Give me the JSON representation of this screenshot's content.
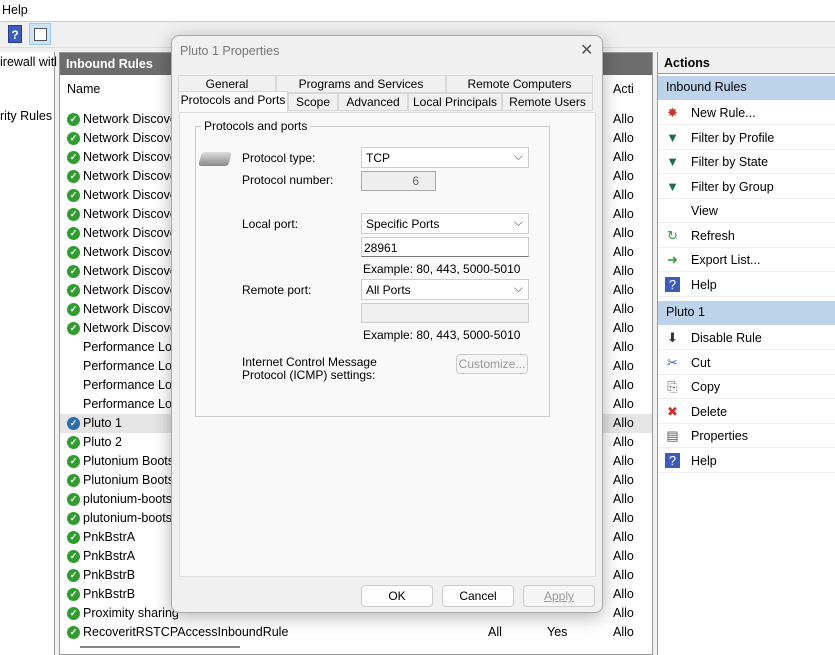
{
  "menubar": {
    "help": "Help"
  },
  "toolbar": {
    "help_icon": "help-icon",
    "view_icon": "show-hide-action-pane-icon"
  },
  "left_pane": {
    "items": [
      "irewall witl",
      "rity Rules"
    ]
  },
  "center": {
    "title": "Inbound Rules",
    "columns": {
      "name": "Name",
      "action": "Acti"
    },
    "rows": [
      {
        "name": "Network Discove",
        "action": "Allo",
        "enabled": true
      },
      {
        "name": "Network Discove",
        "action": "Allo",
        "enabled": true
      },
      {
        "name": "Network Discove",
        "action": "Allo",
        "enabled": true
      },
      {
        "name": "Network Discove",
        "action": "Allo",
        "enabled": true
      },
      {
        "name": "Network Discove",
        "action": "Allo",
        "enabled": true
      },
      {
        "name": "Network Discove",
        "action": "Allo",
        "enabled": true
      },
      {
        "name": "Network Discove",
        "action": "Allo",
        "enabled": true
      },
      {
        "name": "Network Discove",
        "action": "Allo",
        "enabled": true
      },
      {
        "name": "Network Discove",
        "action": "Allo",
        "enabled": true
      },
      {
        "name": "Network Discove",
        "action": "Allo",
        "enabled": true
      },
      {
        "name": "Network Discove",
        "action": "Allo",
        "enabled": true
      },
      {
        "name": "Network Discove",
        "action": "Allo",
        "enabled": true
      },
      {
        "name": "Performance Log",
        "action": "Allo",
        "enabled": false
      },
      {
        "name": "Performance Log",
        "action": "Allo",
        "enabled": false
      },
      {
        "name": "Performance Log",
        "action": "Allo",
        "enabled": false
      },
      {
        "name": "Performance Log",
        "action": "Allo",
        "enabled": false
      },
      {
        "name": "Pluto 1",
        "action": "Allo",
        "enabled": true,
        "selected": true
      },
      {
        "name": "Pluto 2",
        "action": "Allo",
        "enabled": true
      },
      {
        "name": "Plutonium Boots",
        "action": "Allo",
        "enabled": true
      },
      {
        "name": "Plutonium Boots",
        "action": "Allo",
        "enabled": true
      },
      {
        "name": "plutonium-boots",
        "action": "Allo",
        "enabled": true
      },
      {
        "name": "plutonium-boots",
        "action": "Allo",
        "enabled": true
      },
      {
        "name": "PnkBstrA",
        "action": "Allo",
        "enabled": true
      },
      {
        "name": "PnkBstrA",
        "action": "Allo",
        "enabled": true
      },
      {
        "name": "PnkBstrB",
        "action": "Allo",
        "enabled": true
      },
      {
        "name": "PnkBstrB",
        "action": "Allo",
        "enabled": true
      },
      {
        "name": "Proximity sharing",
        "action": "Allo",
        "enabled": true
      },
      {
        "name": "RecoveritRSTCPAccessInboundRule",
        "profile": "All",
        "enabled_text": "Yes",
        "action": "Allo",
        "enabled": true
      }
    ]
  },
  "actions": {
    "title": "Actions",
    "sections": [
      {
        "title": "Inbound Rules",
        "items": [
          {
            "label": "New Rule...",
            "icon": "new-rule-icon"
          },
          {
            "label": "Filter by Profile",
            "icon": "filter-icon"
          },
          {
            "label": "Filter by State",
            "icon": "filter-icon"
          },
          {
            "label": "Filter by Group",
            "icon": "filter-icon"
          },
          {
            "label": "View",
            "icon": ""
          },
          {
            "label": "Refresh",
            "icon": "refresh-icon"
          },
          {
            "label": "Export List...",
            "icon": "export-icon"
          },
          {
            "label": "Help",
            "icon": "help-icon"
          }
        ]
      },
      {
        "title": "Pluto 1",
        "items": [
          {
            "label": "Disable Rule",
            "icon": "disable-icon"
          },
          {
            "label": "Cut",
            "icon": "cut-icon"
          },
          {
            "label": "Copy",
            "icon": "copy-icon"
          },
          {
            "label": "Delete",
            "icon": "delete-icon"
          },
          {
            "label": "Properties",
            "icon": "properties-icon"
          },
          {
            "label": "Help",
            "icon": "help-icon"
          }
        ]
      }
    ]
  },
  "dialog": {
    "title": "Pluto 1 Properties",
    "tabs_top": [
      "General",
      "Programs and Services",
      "Remote Computers"
    ],
    "tabs_bottom": [
      "Protocols and Ports",
      "Scope",
      "Advanced",
      "Local Principals",
      "Remote Users"
    ],
    "active_tab": "Protocols and Ports",
    "group_title": "Protocols and ports",
    "protocol_type_label": "Protocol type:",
    "protocol_type": "TCP",
    "protocol_number_label": "Protocol number:",
    "protocol_number": "6",
    "local_port_label": "Local port:",
    "local_port": "Specific Ports",
    "local_port_value": "28961",
    "local_example": "Example: 80, 443, 5000-5010",
    "remote_port_label": "Remote port:",
    "remote_port": "All Ports",
    "remote_port_value": "",
    "remote_example": "Example: 80, 443, 5000-5010",
    "icmp_label": "Internet Control Message Protocol (ICMP) settings:",
    "customize": "Customize...",
    "ok": "OK",
    "cancel": "Cancel",
    "apply": "Apply"
  }
}
